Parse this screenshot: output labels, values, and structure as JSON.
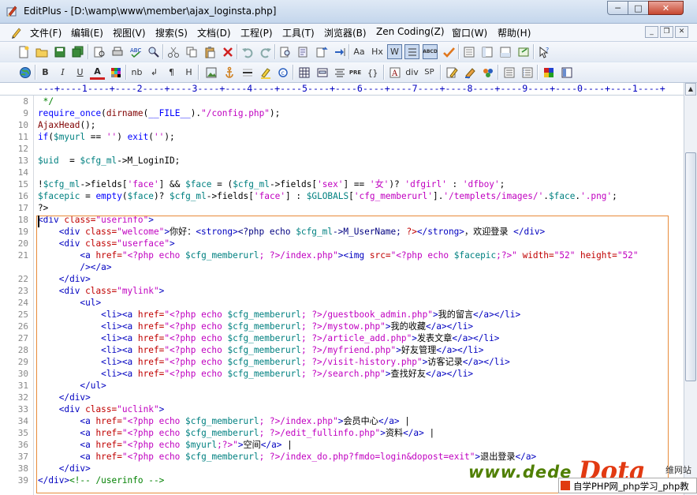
{
  "window": {
    "title": "EditPlus - [D:\\wamp\\www\\member\\ajax_loginsta.php]",
    "min_label": "─",
    "max_label": "□",
    "close_label": "✕"
  },
  "menu": [
    {
      "name": "menu-file",
      "label": "文件(F)"
    },
    {
      "name": "menu-edit",
      "label": "编辑(E)"
    },
    {
      "name": "menu-view",
      "label": "视图(V)"
    },
    {
      "name": "menu-search",
      "label": "搜索(S)"
    },
    {
      "name": "menu-document",
      "label": "文档(D)"
    },
    {
      "name": "menu-project",
      "label": "工程(P)"
    },
    {
      "name": "menu-tools",
      "label": "工具(T)"
    },
    {
      "name": "menu-browser",
      "label": "浏览器(B)"
    },
    {
      "name": "menu-zen-coding",
      "label": "Zen Coding(Z)"
    },
    {
      "name": "menu-window",
      "label": "窗口(W)"
    },
    {
      "name": "menu-help",
      "label": "帮助(H)"
    }
  ],
  "toolbar2_labels": {
    "bold": "B",
    "italic": "I",
    "underline": "U",
    "font": "A",
    "nbsp": "nb",
    "br": "↲",
    "para": "¶",
    "heading": "H",
    "pre": "PRE",
    "div": "div",
    "span": "SP",
    "aa": "Aa",
    "hx": "Hx",
    "w": "W",
    "abcd": "ABCD"
  },
  "ruler": "---+----1----+----2----+----3----+----4----+----5----+----6----+----7----+----8----+----9----+----0----+----1----+",
  "icons": {
    "app": "editplus-icon",
    "scroll_up": "▲",
    "scroll_down": "▼"
  },
  "lines": [
    {
      "n": "8",
      "tokens": [
        [
          " */",
          "t-com"
        ]
      ]
    },
    {
      "n": "9",
      "tokens": [
        [
          "require_once",
          "t-kw"
        ],
        [
          "(",
          "t-op"
        ],
        [
          "dirname",
          "t-fn"
        ],
        [
          "(",
          "t-op"
        ],
        [
          "__FILE__",
          "t-kw"
        ],
        [
          ").",
          "t-op"
        ],
        [
          "\"/config.php\"",
          "t-str"
        ],
        [
          ");",
          "t-op"
        ]
      ]
    },
    {
      "n": "10",
      "tokens": [
        [
          "AjaxHead",
          "t-fn"
        ],
        [
          "();",
          "t-op"
        ]
      ]
    },
    {
      "n": "11",
      "tokens": [
        [
          "if",
          "t-kw"
        ],
        [
          "(",
          "t-op"
        ],
        [
          "$myurl",
          "t-var"
        ],
        [
          " == ",
          "t-op"
        ],
        [
          "''",
          "t-str"
        ],
        [
          ") ",
          "t-op"
        ],
        [
          "exit",
          "t-kw"
        ],
        [
          "(",
          "t-op"
        ],
        [
          "''",
          "t-str"
        ],
        [
          ");",
          "t-op"
        ]
      ]
    },
    {
      "n": "12",
      "tokens": []
    },
    {
      "n": "13",
      "tokens": [
        [
          "$uid",
          "t-var"
        ],
        [
          "  = ",
          "t-op"
        ],
        [
          "$cfg_ml",
          "t-var"
        ],
        [
          "->M_LoginID;",
          "t-op"
        ]
      ]
    },
    {
      "n": "14",
      "tokens": []
    },
    {
      "n": "15",
      "tokens": [
        [
          "!",
          "t-op"
        ],
        [
          "$cfg_ml",
          "t-var"
        ],
        [
          "->fields[",
          "t-op"
        ],
        [
          "'face'",
          "t-str"
        ],
        [
          "] && ",
          "t-op"
        ],
        [
          "$face",
          "t-var"
        ],
        [
          " = (",
          "t-op"
        ],
        [
          "$cfg_ml",
          "t-var"
        ],
        [
          "->fields[",
          "t-op"
        ],
        [
          "'sex'",
          "t-str"
        ],
        [
          "] == ",
          "t-op"
        ],
        [
          "'女'",
          "t-str"
        ],
        [
          ")? ",
          "t-op"
        ],
        [
          "'dfgirl'",
          "t-str"
        ],
        [
          " : ",
          "t-op"
        ],
        [
          "'dfboy'",
          "t-str"
        ],
        [
          ";",
          "t-op"
        ]
      ]
    },
    {
      "n": "16",
      "tokens": [
        [
          "$facepic",
          "t-var"
        ],
        [
          " = ",
          "t-op"
        ],
        [
          "empty",
          "t-kw"
        ],
        [
          "(",
          "t-op"
        ],
        [
          "$face",
          "t-var"
        ],
        [
          ")? ",
          "t-op"
        ],
        [
          "$cfg_ml",
          "t-var"
        ],
        [
          "->fields[",
          "t-op"
        ],
        [
          "'face'",
          "t-str"
        ],
        [
          "] : ",
          "t-op"
        ],
        [
          "$GLOBALS",
          "t-var"
        ],
        [
          "[",
          "t-op"
        ],
        [
          "'cfg_memberurl'",
          "t-str"
        ],
        [
          "].",
          "t-op"
        ],
        [
          "'/templets/images/'",
          "t-str"
        ],
        [
          ".",
          "t-op"
        ],
        [
          "$face",
          "t-var"
        ],
        [
          ".",
          "t-op"
        ],
        [
          "'.png'",
          "t-str"
        ],
        [
          ";",
          "t-op"
        ]
      ]
    },
    {
      "n": "17",
      "tokens": [
        [
          "?>",
          "t-op"
        ]
      ]
    },
    {
      "n": "18",
      "tokens": [
        [
          "<div ",
          "t-tag"
        ],
        [
          "class=",
          "t-attr"
        ],
        [
          "\"userinfo\"",
          "t-val"
        ],
        [
          ">",
          "t-tag"
        ]
      ]
    },
    {
      "n": "19",
      "tokens": [
        [
          "    <div ",
          "t-tag"
        ],
        [
          "class=",
          "t-attr"
        ],
        [
          "\"welcome\"",
          "t-val"
        ],
        [
          ">",
          "t-tag"
        ],
        [
          "你好：",
          "t-op"
        ],
        [
          "<strong>",
          "t-tag"
        ],
        [
          "<?php echo ",
          "t-php"
        ],
        [
          "$cfg_ml",
          "t-var"
        ],
        [
          "->M_UserName; ",
          "t-php"
        ],
        [
          "?>",
          "t-attr"
        ],
        [
          "</strong>",
          "t-tag"
        ],
        [
          "，欢迎登录 ",
          "t-op"
        ],
        [
          "</div>",
          "t-tag"
        ]
      ]
    },
    {
      "n": "20",
      "tokens": [
        [
          "    <div ",
          "t-tag"
        ],
        [
          "class=",
          "t-attr"
        ],
        [
          "\"userface\"",
          "t-val"
        ],
        [
          ">",
          "t-tag"
        ]
      ]
    },
    {
      "n": "21",
      "tokens": [
        [
          "        <a ",
          "t-tag"
        ],
        [
          "href=",
          "t-attr"
        ],
        [
          "\"<?php echo ",
          "t-val"
        ],
        [
          "$cfg_memberurl",
          "t-var"
        ],
        [
          "; ?>",
          "t-val"
        ],
        [
          "/index.php\"",
          "t-val"
        ],
        [
          ">",
          "t-tag"
        ],
        [
          "<img ",
          "t-tag"
        ],
        [
          "src=",
          "t-attr"
        ],
        [
          "\"<?php echo ",
          "t-val"
        ],
        [
          "$facepic",
          "t-var"
        ],
        [
          ";?>\"",
          "t-val"
        ],
        [
          " width=",
          "t-attr"
        ],
        [
          "\"52\"",
          "t-val"
        ],
        [
          " height=",
          "t-attr"
        ],
        [
          "\"52\"",
          "t-val"
        ]
      ]
    },
    {
      "n": "",
      "tokens": [
        [
          "        /></a>",
          "t-tag"
        ]
      ]
    },
    {
      "n": "22",
      "tokens": [
        [
          "    </div>",
          "t-tag"
        ]
      ]
    },
    {
      "n": "23",
      "tokens": [
        [
          "    <div ",
          "t-tag"
        ],
        [
          "class=",
          "t-attr"
        ],
        [
          "\"mylink\"",
          "t-val"
        ],
        [
          ">",
          "t-tag"
        ]
      ]
    },
    {
      "n": "24",
      "tokens": [
        [
          "        <ul>",
          "t-tag"
        ]
      ]
    },
    {
      "n": "25",
      "tokens": [
        [
          "            <li><a ",
          "t-tag"
        ],
        [
          "href=",
          "t-attr"
        ],
        [
          "\"<?php echo ",
          "t-val"
        ],
        [
          "$cfg_memberurl",
          "t-var"
        ],
        [
          "; ?>",
          "t-val"
        ],
        [
          "/guestbook_admin.php\"",
          "t-val"
        ],
        [
          ">",
          "t-tag"
        ],
        [
          "我的留言",
          "t-op"
        ],
        [
          "</a></li>",
          "t-tag"
        ]
      ]
    },
    {
      "n": "26",
      "tokens": [
        [
          "            <li><a ",
          "t-tag"
        ],
        [
          "href=",
          "t-attr"
        ],
        [
          "\"<?php echo ",
          "t-val"
        ],
        [
          "$cfg_memberurl",
          "t-var"
        ],
        [
          "; ?>",
          "t-val"
        ],
        [
          "/mystow.php\"",
          "t-val"
        ],
        [
          ">",
          "t-tag"
        ],
        [
          "我的收藏",
          "t-op"
        ],
        [
          "</a></li>",
          "t-tag"
        ]
      ]
    },
    {
      "n": "27",
      "tokens": [
        [
          "            <li><a ",
          "t-tag"
        ],
        [
          "href=",
          "t-attr"
        ],
        [
          "\"<?php echo ",
          "t-val"
        ],
        [
          "$cfg_memberurl",
          "t-var"
        ],
        [
          "; ?>",
          "t-val"
        ],
        [
          "/article_add.php\"",
          "t-val"
        ],
        [
          ">",
          "t-tag"
        ],
        [
          "发表文章",
          "t-op"
        ],
        [
          "</a></li>",
          "t-tag"
        ]
      ]
    },
    {
      "n": "28",
      "tokens": [
        [
          "            <li><a ",
          "t-tag"
        ],
        [
          "href=",
          "t-attr"
        ],
        [
          "\"<?php echo ",
          "t-val"
        ],
        [
          "$cfg_memberurl",
          "t-var"
        ],
        [
          "; ?>",
          "t-val"
        ],
        [
          "/myfriend.php\"",
          "t-val"
        ],
        [
          ">",
          "t-tag"
        ],
        [
          "好友管理",
          "t-op"
        ],
        [
          "</a></li>",
          "t-tag"
        ]
      ]
    },
    {
      "n": "29",
      "tokens": [
        [
          "            <li><a ",
          "t-tag"
        ],
        [
          "href=",
          "t-attr"
        ],
        [
          "\"<?php echo ",
          "t-val"
        ],
        [
          "$cfg_memberurl",
          "t-var"
        ],
        [
          "; ?>",
          "t-val"
        ],
        [
          "/visit-history.php\"",
          "t-val"
        ],
        [
          ">",
          "t-tag"
        ],
        [
          "访客记录",
          "t-op"
        ],
        [
          "</a></li>",
          "t-tag"
        ]
      ]
    },
    {
      "n": "30",
      "tokens": [
        [
          "            <li><a ",
          "t-tag"
        ],
        [
          "href=",
          "t-attr"
        ],
        [
          "\"<?php echo ",
          "t-val"
        ],
        [
          "$cfg_memberurl",
          "t-var"
        ],
        [
          "; ?>",
          "t-val"
        ],
        [
          "/search.php\"",
          "t-val"
        ],
        [
          ">",
          "t-tag"
        ],
        [
          "查找好友",
          "t-op"
        ],
        [
          "</a></li>",
          "t-tag"
        ]
      ]
    },
    {
      "n": "31",
      "tokens": [
        [
          "        </ul>",
          "t-tag"
        ]
      ]
    },
    {
      "n": "32",
      "tokens": [
        [
          "    </div>",
          "t-tag"
        ]
      ]
    },
    {
      "n": "33",
      "tokens": [
        [
          "    <div ",
          "t-tag"
        ],
        [
          "class=",
          "t-attr"
        ],
        [
          "\"uclink\"",
          "t-val"
        ],
        [
          ">",
          "t-tag"
        ]
      ]
    },
    {
      "n": "34",
      "tokens": [
        [
          "        <a ",
          "t-tag"
        ],
        [
          "href=",
          "t-attr"
        ],
        [
          "\"<?php echo ",
          "t-val"
        ],
        [
          "$cfg_memberurl",
          "t-var"
        ],
        [
          "; ?>",
          "t-val"
        ],
        [
          "/index.php\"",
          "t-val"
        ],
        [
          ">",
          "t-tag"
        ],
        [
          "会员中心",
          "t-op"
        ],
        [
          "</a>",
          "t-tag"
        ],
        [
          " |",
          "t-op"
        ]
      ]
    },
    {
      "n": "35",
      "tokens": [
        [
          "        <a ",
          "t-tag"
        ],
        [
          "href=",
          "t-attr"
        ],
        [
          "\"<?php echo ",
          "t-val"
        ],
        [
          "$cfg_memberurl",
          "t-var"
        ],
        [
          "; ?>",
          "t-val"
        ],
        [
          "/edit_fullinfo.php\"",
          "t-val"
        ],
        [
          ">",
          "t-tag"
        ],
        [
          "资料",
          "t-op"
        ],
        [
          "</a>",
          "t-tag"
        ],
        [
          " |",
          "t-op"
        ]
      ]
    },
    {
      "n": "36",
      "tokens": [
        [
          "        <a ",
          "t-tag"
        ],
        [
          "href=",
          "t-attr"
        ],
        [
          "\"<?php echo ",
          "t-val"
        ],
        [
          "$myurl",
          "t-var"
        ],
        [
          ";?>\"",
          "t-val"
        ],
        [
          ">",
          "t-tag"
        ],
        [
          "空间",
          "t-op"
        ],
        [
          "</a>",
          "t-tag"
        ],
        [
          " |",
          "t-op"
        ]
      ]
    },
    {
      "n": "37",
      "tokens": [
        [
          "        <a ",
          "t-tag"
        ],
        [
          "href=",
          "t-attr"
        ],
        [
          "\"<?php echo ",
          "t-val"
        ],
        [
          "$cfg_memberurl",
          "t-var"
        ],
        [
          "; ?>",
          "t-val"
        ],
        [
          "/index_do.php?fmdo=login&dopost=exit\"",
          "t-val"
        ],
        [
          ">",
          "t-tag"
        ],
        [
          "退出登录",
          "t-op"
        ],
        [
          "</a>",
          "t-tag"
        ]
      ]
    },
    {
      "n": "38",
      "tokens": [
        [
          "    </div>",
          "t-tag"
        ]
      ]
    },
    {
      "n": "39",
      "tokens": [
        [
          "</div>",
          "t-tag"
        ],
        [
          "<!-- /userinfo -->",
          "t-com"
        ]
      ]
    }
  ],
  "watermark": {
    "site": "www.dede",
    "logo": "Dota",
    "cn": "维网站",
    "strip": "自学PHP网_php学习_php教"
  }
}
